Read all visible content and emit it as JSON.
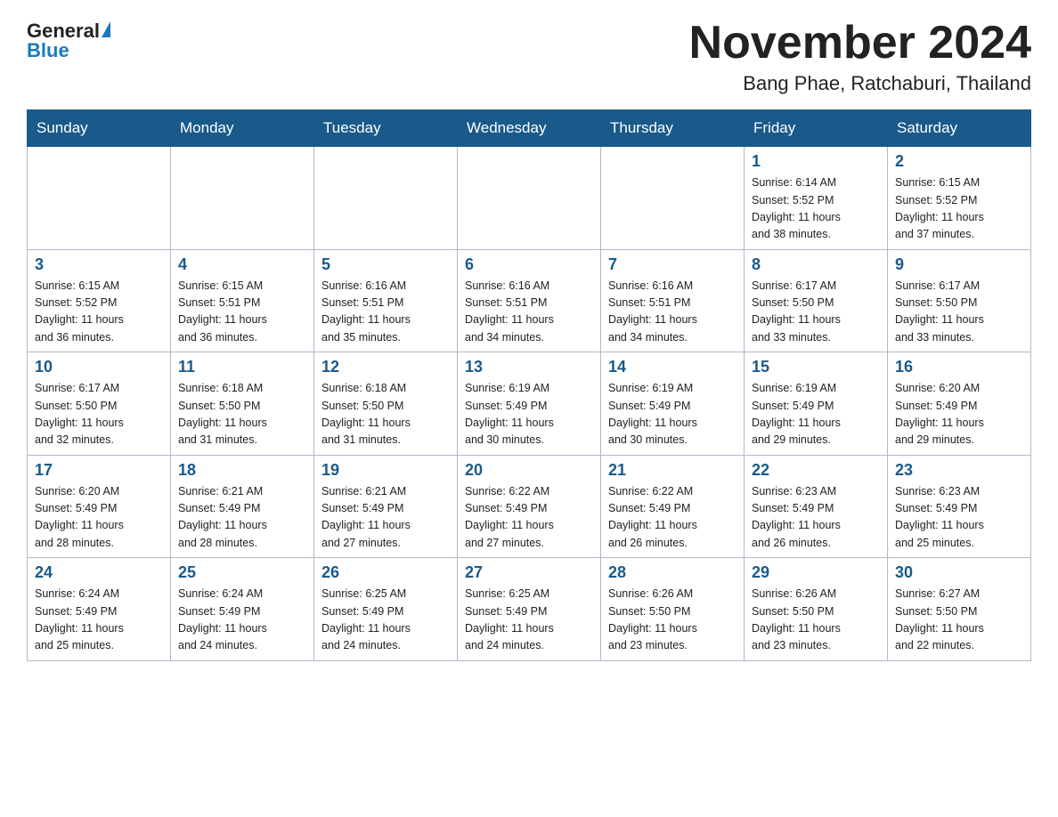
{
  "header": {
    "logo_general": "General",
    "logo_blue": "Blue",
    "month_year": "November 2024",
    "location": "Bang Phae, Ratchaburi, Thailand"
  },
  "weekdays": [
    "Sunday",
    "Monday",
    "Tuesday",
    "Wednesday",
    "Thursday",
    "Friday",
    "Saturday"
  ],
  "weeks": [
    [
      {
        "day": "",
        "info": ""
      },
      {
        "day": "",
        "info": ""
      },
      {
        "day": "",
        "info": ""
      },
      {
        "day": "",
        "info": ""
      },
      {
        "day": "",
        "info": ""
      },
      {
        "day": "1",
        "info": "Sunrise: 6:14 AM\nSunset: 5:52 PM\nDaylight: 11 hours\nand 38 minutes."
      },
      {
        "day": "2",
        "info": "Sunrise: 6:15 AM\nSunset: 5:52 PM\nDaylight: 11 hours\nand 37 minutes."
      }
    ],
    [
      {
        "day": "3",
        "info": "Sunrise: 6:15 AM\nSunset: 5:52 PM\nDaylight: 11 hours\nand 36 minutes."
      },
      {
        "day": "4",
        "info": "Sunrise: 6:15 AM\nSunset: 5:51 PM\nDaylight: 11 hours\nand 36 minutes."
      },
      {
        "day": "5",
        "info": "Sunrise: 6:16 AM\nSunset: 5:51 PM\nDaylight: 11 hours\nand 35 minutes."
      },
      {
        "day": "6",
        "info": "Sunrise: 6:16 AM\nSunset: 5:51 PM\nDaylight: 11 hours\nand 34 minutes."
      },
      {
        "day": "7",
        "info": "Sunrise: 6:16 AM\nSunset: 5:51 PM\nDaylight: 11 hours\nand 34 minutes."
      },
      {
        "day": "8",
        "info": "Sunrise: 6:17 AM\nSunset: 5:50 PM\nDaylight: 11 hours\nand 33 minutes."
      },
      {
        "day": "9",
        "info": "Sunrise: 6:17 AM\nSunset: 5:50 PM\nDaylight: 11 hours\nand 33 minutes."
      }
    ],
    [
      {
        "day": "10",
        "info": "Sunrise: 6:17 AM\nSunset: 5:50 PM\nDaylight: 11 hours\nand 32 minutes."
      },
      {
        "day": "11",
        "info": "Sunrise: 6:18 AM\nSunset: 5:50 PM\nDaylight: 11 hours\nand 31 minutes."
      },
      {
        "day": "12",
        "info": "Sunrise: 6:18 AM\nSunset: 5:50 PM\nDaylight: 11 hours\nand 31 minutes."
      },
      {
        "day": "13",
        "info": "Sunrise: 6:19 AM\nSunset: 5:49 PM\nDaylight: 11 hours\nand 30 minutes."
      },
      {
        "day": "14",
        "info": "Sunrise: 6:19 AM\nSunset: 5:49 PM\nDaylight: 11 hours\nand 30 minutes."
      },
      {
        "day": "15",
        "info": "Sunrise: 6:19 AM\nSunset: 5:49 PM\nDaylight: 11 hours\nand 29 minutes."
      },
      {
        "day": "16",
        "info": "Sunrise: 6:20 AM\nSunset: 5:49 PM\nDaylight: 11 hours\nand 29 minutes."
      }
    ],
    [
      {
        "day": "17",
        "info": "Sunrise: 6:20 AM\nSunset: 5:49 PM\nDaylight: 11 hours\nand 28 minutes."
      },
      {
        "day": "18",
        "info": "Sunrise: 6:21 AM\nSunset: 5:49 PM\nDaylight: 11 hours\nand 28 minutes."
      },
      {
        "day": "19",
        "info": "Sunrise: 6:21 AM\nSunset: 5:49 PM\nDaylight: 11 hours\nand 27 minutes."
      },
      {
        "day": "20",
        "info": "Sunrise: 6:22 AM\nSunset: 5:49 PM\nDaylight: 11 hours\nand 27 minutes."
      },
      {
        "day": "21",
        "info": "Sunrise: 6:22 AM\nSunset: 5:49 PM\nDaylight: 11 hours\nand 26 minutes."
      },
      {
        "day": "22",
        "info": "Sunrise: 6:23 AM\nSunset: 5:49 PM\nDaylight: 11 hours\nand 26 minutes."
      },
      {
        "day": "23",
        "info": "Sunrise: 6:23 AM\nSunset: 5:49 PM\nDaylight: 11 hours\nand 25 minutes."
      }
    ],
    [
      {
        "day": "24",
        "info": "Sunrise: 6:24 AM\nSunset: 5:49 PM\nDaylight: 11 hours\nand 25 minutes."
      },
      {
        "day": "25",
        "info": "Sunrise: 6:24 AM\nSunset: 5:49 PM\nDaylight: 11 hours\nand 24 minutes."
      },
      {
        "day": "26",
        "info": "Sunrise: 6:25 AM\nSunset: 5:49 PM\nDaylight: 11 hours\nand 24 minutes."
      },
      {
        "day": "27",
        "info": "Sunrise: 6:25 AM\nSunset: 5:49 PM\nDaylight: 11 hours\nand 24 minutes."
      },
      {
        "day": "28",
        "info": "Sunrise: 6:26 AM\nSunset: 5:50 PM\nDaylight: 11 hours\nand 23 minutes."
      },
      {
        "day": "29",
        "info": "Sunrise: 6:26 AM\nSunset: 5:50 PM\nDaylight: 11 hours\nand 23 minutes."
      },
      {
        "day": "30",
        "info": "Sunrise: 6:27 AM\nSunset: 5:50 PM\nDaylight: 11 hours\nand 22 minutes."
      }
    ]
  ]
}
